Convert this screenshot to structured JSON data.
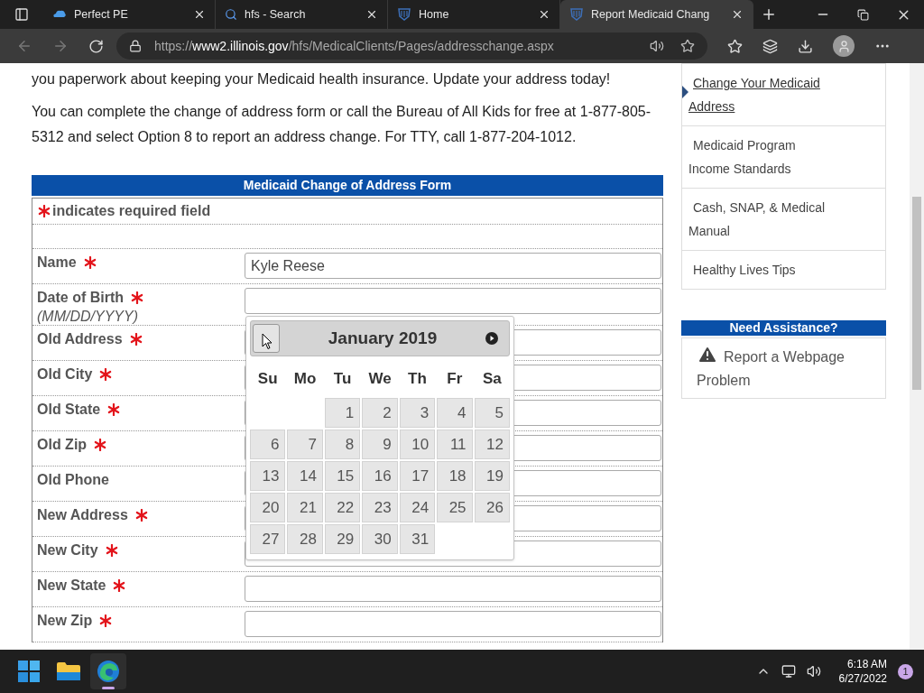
{
  "browser": {
    "tabs": [
      {
        "title": "Perfect PE",
        "kind": "cloud",
        "selected": false
      },
      {
        "title": "hfs - Search",
        "kind": "search",
        "selected": false
      },
      {
        "title": "Home",
        "kind": "seal",
        "selected": false
      },
      {
        "title": "Report Medicaid Chang",
        "kind": "seal",
        "selected": true
      }
    ],
    "url": {
      "scheme": "https://",
      "host": "www2.illinois.gov",
      "path": "/hfs/MedicalClients/Pages/addresschange.aspx"
    }
  },
  "content": {
    "paragraphs": [
      "you paperwork about keeping your Medicaid health insurance. Update your address today!",
      "You can complete the change of address form or call the Bureau of All Kids for free at 1-877-805-5312 and select Option 8 to report an address change. For TTY, call 1-877-204-1012."
    ]
  },
  "form": {
    "title": "Medicaid Change of Address Form",
    "required_note": "indicates required field",
    "fields": [
      {
        "label": "Name",
        "required": true,
        "value": "Kyle Reese"
      },
      {
        "label": "Date of Birth",
        "required": true,
        "hint": "(MM/DD/YYYY)"
      },
      {
        "label": "Old Address",
        "required": true
      },
      {
        "label": "Old City",
        "required": true
      },
      {
        "label": "Old State",
        "required": true
      },
      {
        "label": "Old Zip",
        "required": true
      },
      {
        "label": "Old Phone",
        "required": false
      },
      {
        "label": "New Address",
        "required": true
      },
      {
        "label": "New City",
        "required": true
      },
      {
        "label": "New State",
        "required": true
      },
      {
        "label": "New Zip",
        "required": true
      }
    ]
  },
  "datepicker": {
    "title": "January 2019",
    "weekdays": [
      "Su",
      "Mo",
      "Tu",
      "We",
      "Th",
      "Fr",
      "Sa"
    ],
    "weeks": [
      [
        "1",
        "2",
        "3",
        "4",
        "5"
      ],
      [
        "6",
        "7",
        "8",
        "9",
        "10",
        "11",
        "12"
      ],
      [
        "13",
        "14",
        "15",
        "16",
        "17",
        "18",
        "19"
      ],
      [
        "20",
        "21",
        "22",
        "23",
        "24",
        "25",
        "26"
      ],
      [
        "27",
        "28",
        "29",
        "30",
        "31"
      ]
    ]
  },
  "sidebar": {
    "links": [
      {
        "label": "Change Your Medicaid Address",
        "selected": true
      },
      {
        "label": "Medicaid Program Income Standards",
        "selected": false
      },
      {
        "label": "Cash, SNAP, & Medical Manual",
        "selected": false
      },
      {
        "label": "Healthy Lives Tips",
        "selected": false
      }
    ],
    "assistance": {
      "title": "Need Assistance?",
      "link": "Report a Webpage Problem"
    }
  },
  "taskbar": {
    "apps": [
      {
        "kind": "start",
        "selected": false
      },
      {
        "kind": "folder",
        "selected": false
      },
      {
        "kind": "edge",
        "selected": true
      }
    ],
    "time": "6:18 AM",
    "date": "6/27/2022",
    "notifications": "1"
  }
}
